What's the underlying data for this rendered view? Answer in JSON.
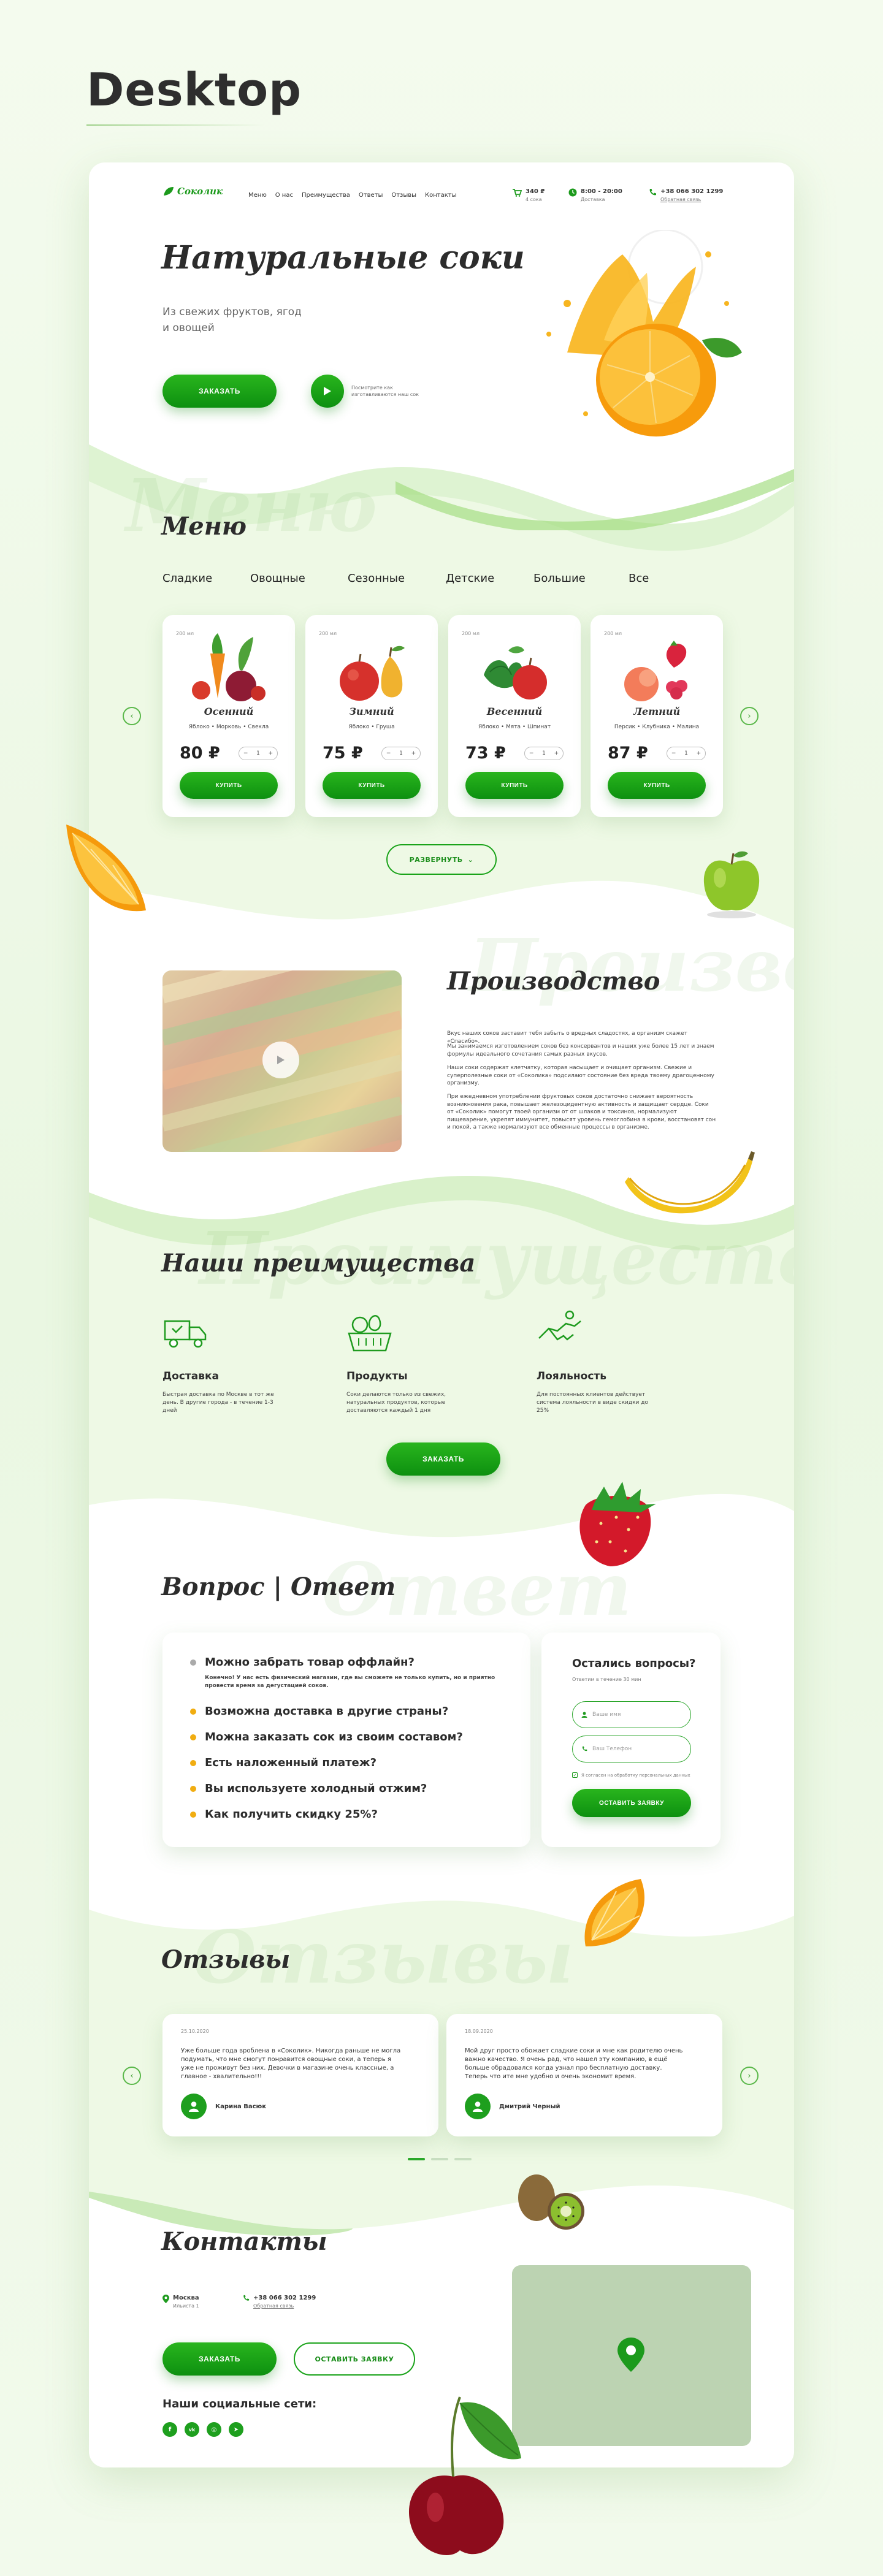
{
  "showcase_title": "Desktop",
  "header": {
    "logo": "Соколик",
    "nav": [
      "Меню",
      "О нас",
      "Преимущества",
      "Ответы",
      "Отзывы",
      "Контакты"
    ],
    "cart": {
      "value": "340 ₽",
      "sub": "4 сока"
    },
    "hours": {
      "value": "8:00 - 20:00",
      "sub": "Доставка"
    },
    "phone": {
      "value": "+38 066 302 1299",
      "sub": "Обратная связь"
    }
  },
  "hero": {
    "title": "Натуральные соки",
    "subtitle_line1": "Из свежих фруктов, ягод",
    "subtitle_line2": "и овощей",
    "order_button": "ЗАКАЗАТЬ",
    "video_text_line1": "Посмотрите как",
    "video_text_line2": "изготавливаются наш сок"
  },
  "menu": {
    "ghost": "Меню",
    "title": "Меню",
    "filters": [
      "Сладкие",
      "Овощные",
      "Сезонные",
      "Детские",
      "Большие",
      "Все"
    ],
    "cards": [
      {
        "volume": "200 мл",
        "name": "Осенний",
        "ingredients": "Яблоко  •  Морковь  •  Свекла",
        "price": "80 ₽",
        "buy": "КУПИТЬ"
      },
      {
        "volume": "200 мл",
        "name": "Зимний",
        "ingredients": "Яблоко  •  Груша",
        "price": "75 ₽",
        "buy": "КУПИТЬ"
      },
      {
        "volume": "200 мл",
        "name": "Весенний",
        "ingredients": "Яблоко  •  Мята  •  Шпинат",
        "price": "73 ₽",
        "buy": "КУПИТЬ"
      },
      {
        "volume": "200 мл",
        "name": "Летний",
        "ingredients": "Персик  •  Клубника  •  Малина",
        "price": "87 ₽",
        "buy": "КУПИТЬ"
      }
    ],
    "stepper": {
      "minus": "−",
      "qty": "1",
      "plus": "+"
    },
    "expand_button": "РАЗВЕРНУТЬ"
  },
  "production": {
    "ghost": "Производство",
    "title": "Производство",
    "paragraphs": [
      "Вкус наших соков заставит тебя забыть о вредных сладостях, а организм скажет «Спасибо».",
      "Мы занимаемся изготовлением соков без консервантов и наших уже более 15 лет и знаем формулы идеального сочетания самых разных вкусов.",
      "Наши соки содержат клетчатку, которая насыщает и очищает организм. Свежие и суперполезные соки от «Соколика» подсилают состояние без вреда твоему драгоценному организму.",
      "При ежедневном употреблении фруктовых соков достаточно снижает вероятность возникновения рака, повышает железоцидентную активность и защищает сердце. Соки от «Соколик» помогут твоей организм от от шлаков и токсинов, нормализуют пищеварение, укрепят иммунитет, повысят уровень гемоглобина в крови, восстановят сон и покой, а также нормализуют все обменные процессы в организме."
    ]
  },
  "advantages": {
    "ghost": "Преимущества",
    "title": "Наши преимущества",
    "items": [
      {
        "icon": "delivery-truck-icon",
        "title": "Доставка",
        "text": "Быстрая доставка по Москве в тот же день. В другие города - в течение 1-3 дней"
      },
      {
        "icon": "fruit-basket-icon",
        "title": "Продукты",
        "text": "Соки делаются только из свежих, натуральных продуктов, которые доставляются каждый 1 дня"
      },
      {
        "icon": "handshake-icon",
        "title": "Лояльность",
        "text": "Для постоянных клиентов действует система лояльности в виде скидки до 25%"
      }
    ],
    "order_button": "ЗАКАЗАТЬ"
  },
  "faq": {
    "ghost": "Ответ",
    "title": "Вопрос | Ответ",
    "items": [
      "Можно забрать товар оффлайн?",
      "Возможна доставка в другие страны?",
      "Можна заказать сок из своим составом?",
      "Есть наложенный платеж?",
      "Вы используете холодный отжим?",
      "Как получить скидку 25%?"
    ],
    "open_answer": "Конечно! У нас есть физический магазин, где вы сможете не только купить, но и приятно провести время за дегустацией соков."
  },
  "contact_form": {
    "title": "Остались вопросы?",
    "subtitle": "Ответим в течение 30 мин",
    "name_placeholder": "Ваше имя",
    "phone_placeholder": "Ваш Телефон",
    "consent": "Я согласен на обработку персональных данных",
    "submit": "ОСТАВИТЬ ЗАЯВКУ"
  },
  "reviews": {
    "ghost": "Отзывы",
    "title": "Отзывы",
    "items": [
      {
        "date": "25.10.2020",
        "text": "Уже больше года вроблена в «Соколик». Никогда раньше не могла подумать, что мне смогут понравится овощные соки, а теперь я уже не проживут без них. Девочки в магазине очень классные, а главное - хвалительно!!!",
        "author": "Карина Васюк"
      },
      {
        "date": "18.09.2020",
        "text": "Мой друг просто обожает сладкие соки и мне как родителю очень важно качество. Я очень рад, что нашел эту компанию, в ещё больше обрадовался когда узнал про бесплатную доставку. Теперь что ите мне удобно и очень экономит время.",
        "author": "Дмитрий Черный"
      }
    ]
  },
  "contacts": {
    "title": "Контакты",
    "city": "Москва",
    "address": "Ильиста 1",
    "phone": "+38 066 302 1299",
    "phone_sub": "Обратная связь",
    "order_button": "ЗАКАЗАТЬ",
    "request_button": "ОСТАВИТЬ ЗАЯВКУ",
    "social_title": "Наши социальные сети:",
    "socials": [
      {
        "icon": "facebook-icon",
        "glyph": "f"
      },
      {
        "icon": "vk-icon",
        "glyph": "vk"
      },
      {
        "icon": "instagram-icon",
        "glyph": "◎"
      },
      {
        "icon": "telegram-icon",
        "glyph": "➤"
      }
    ]
  },
  "colors": {
    "accent": "#169f16",
    "orange": "#f6a313",
    "background": "#eef9e5"
  }
}
